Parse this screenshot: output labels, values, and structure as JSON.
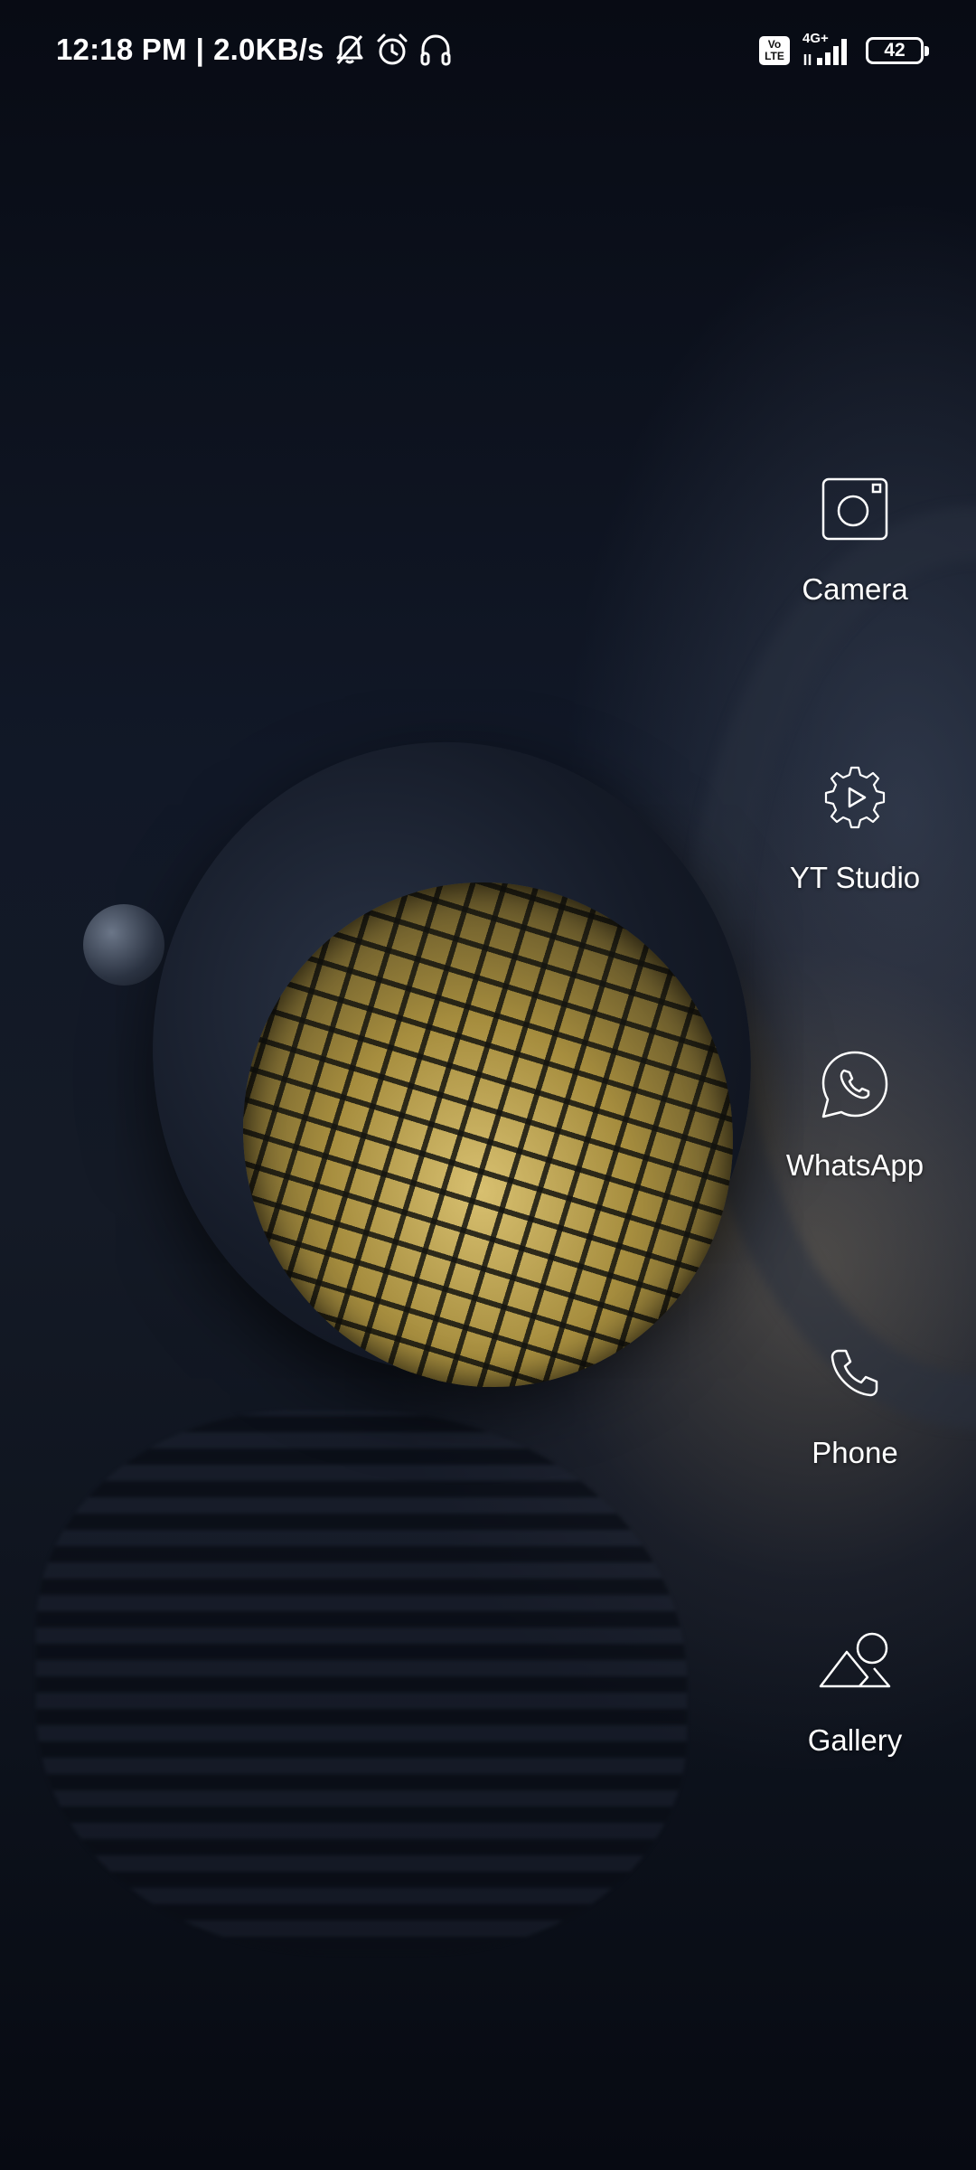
{
  "status_bar": {
    "time": "12:18 PM",
    "separator": "|",
    "net_speed": "2.0KB/s",
    "icons": [
      "notifications-muted-icon",
      "alarm-icon",
      "headphones-icon"
    ],
    "volte_label": "Vo\nLTE",
    "network_type": "4G+",
    "battery_level": "42"
  },
  "apps": [
    {
      "label": "Camera",
      "icon": "camera-icon"
    },
    {
      "label": "YT Studio",
      "icon": "yt-studio-icon"
    },
    {
      "label": "WhatsApp",
      "icon": "whatsapp-icon"
    },
    {
      "label": "Phone",
      "icon": "phone-icon"
    },
    {
      "label": "Gallery",
      "icon": "gallery-icon"
    }
  ]
}
